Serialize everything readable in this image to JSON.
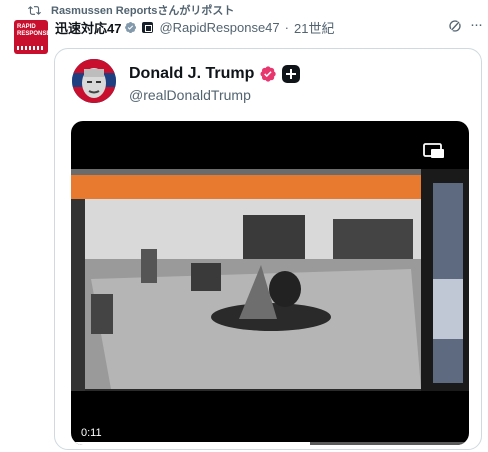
{
  "repost": {
    "text": "Rasmussen Reportsさんがリポスト",
    "icon": "repost-icon"
  },
  "post": {
    "display_name": "迅速対応47",
    "handle": "@RapidResponse47",
    "separator": "·",
    "time": "21世紀",
    "avatar_text": "RAPID RESPONSE"
  },
  "quote": {
    "display_name": "Donald J. Trump",
    "handle": "@realDonaldTrump"
  },
  "video": {
    "elapsed": "0:11",
    "progress": 0.6
  },
  "colors": {
    "verified_blue": "#1d9bf0",
    "verified_pink": "#e8376e",
    "muted": "#536471"
  }
}
